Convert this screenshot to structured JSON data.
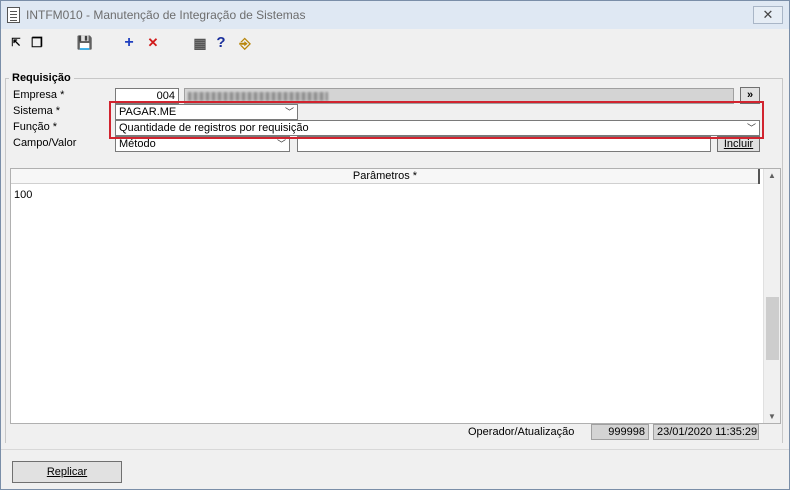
{
  "window": {
    "title": "INTFM010 - Manutenção de Integração de Sistemas",
    "close_glyph": "✕"
  },
  "toolbar": {
    "tools": [
      {
        "name": "navigate-icon",
        "glyph": "⇱"
      },
      {
        "name": "copy-icon",
        "glyph": "❐"
      },
      {
        "name": "save-icon",
        "glyph": "💾"
      },
      {
        "name": "add-icon",
        "glyph": "+"
      },
      {
        "name": "delete-icon",
        "glyph": "✕"
      },
      {
        "name": "calculator-icon",
        "glyph": "▦"
      },
      {
        "name": "help-icon",
        "glyph": "?"
      },
      {
        "name": "exit-icon",
        "glyph": "⎆"
      }
    ]
  },
  "form": {
    "group_title": "Requisição",
    "empresa_label": "Empresa *",
    "empresa_value": "004",
    "sistema_label": "Sistema *",
    "sistema_value": "PAGAR.ME",
    "funcao_label": "Função *",
    "funcao_value": "Quantidade de registros por requisição",
    "campo_label": "Campo/Valor",
    "campo_value": "Método",
    "campo_input_value": "",
    "incluir_label": "Incluir",
    "lookup_label": "»"
  },
  "params": {
    "header": "Parâmetros *",
    "content": "100"
  },
  "footer": {
    "operator_label": "Operador/Atualização",
    "operator_value": "999998",
    "updated_value": "23/01/2020 11:35:29"
  },
  "actions": {
    "replicar_label": "Replicar"
  },
  "colors": {
    "highlight": "#d1242f",
    "add_icon": "#1f3fbf",
    "delete_icon": "#d11a1a"
  }
}
